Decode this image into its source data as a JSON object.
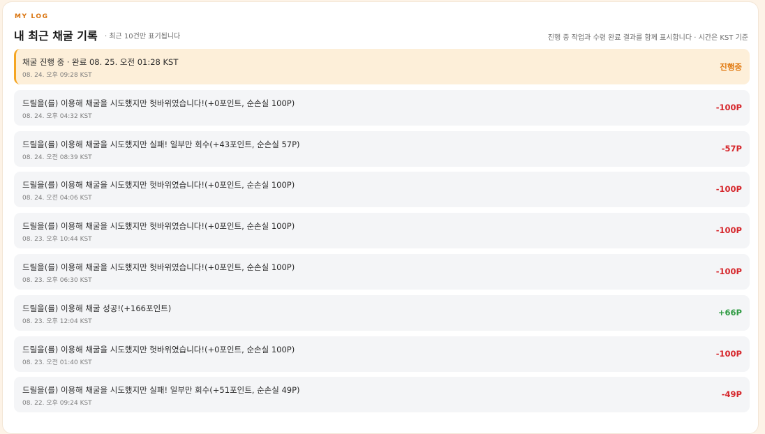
{
  "header": {
    "eyebrow": "MY LOG",
    "title": "내 최근 채굴 기록",
    "subtitle": "· 최근 10건만 표기됩니다",
    "note": "진행 중 작업과 수령 완료 결과를 함께 표시합니다 · 시간은 KST 기준"
  },
  "colors": {
    "accent": "#d9730d",
    "active_bg": "#fdefd9",
    "active_border": "#f5a623",
    "negative": "#d6262b",
    "positive": "#2e9a42"
  },
  "logs": [
    {
      "text": "채굴 진행 중 · 완료 08. 25. 오전 01:28 KST",
      "time": "08. 24. 오후 09:28 KST",
      "badge": "진행중",
      "status": "pending"
    },
    {
      "text": "드릴을(를) 이용해 채굴을 시도했지만 헛바위였습니다!(+0포인트, 순손실 100P)",
      "time": "08. 24. 오후 04:32 KST",
      "badge": "-100P",
      "status": "neg"
    },
    {
      "text": "드릴을(를) 이용해 채굴을 시도했지만 실패! 일부만 회수(+43포인트, 순손실 57P)",
      "time": "08. 24. 오전 08:39 KST",
      "badge": "-57P",
      "status": "neg"
    },
    {
      "text": "드릴을(를) 이용해 채굴을 시도했지만 헛바위였습니다!(+0포인트, 순손실 100P)",
      "time": "08. 24. 오전 04:06 KST",
      "badge": "-100P",
      "status": "neg"
    },
    {
      "text": "드릴을(를) 이용해 채굴을 시도했지만 헛바위였습니다!(+0포인트, 순손실 100P)",
      "time": "08. 23. 오후 10:44 KST",
      "badge": "-100P",
      "status": "neg"
    },
    {
      "text": "드릴을(를) 이용해 채굴을 시도했지만 헛바위였습니다!(+0포인트, 순손실 100P)",
      "time": "08. 23. 오후 06:30 KST",
      "badge": "-100P",
      "status": "neg"
    },
    {
      "text": "드릴을(를) 이용해 채굴 성공!(+166포인트)",
      "time": "08. 23. 오후 12:04 KST",
      "badge": "+66P",
      "status": "pos"
    },
    {
      "text": "드릴을(를) 이용해 채굴을 시도했지만 헛바위였습니다!(+0포인트, 순손실 100P)",
      "time": "08. 23. 오전 01:40 KST",
      "badge": "-100P",
      "status": "neg"
    },
    {
      "text": "드릴을(를) 이용해 채굴을 시도했지만 실패! 일부만 회수(+51포인트, 순손실 49P)",
      "time": "08. 22. 오후 09:24 KST",
      "badge": "-49P",
      "status": "neg"
    }
  ]
}
